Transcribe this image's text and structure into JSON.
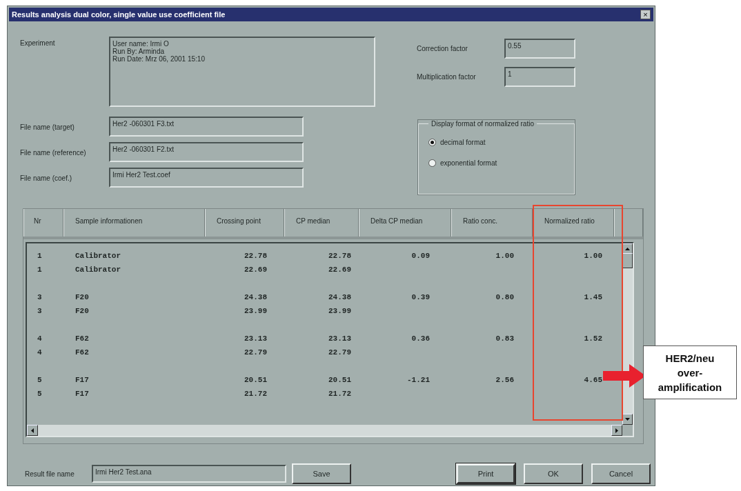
{
  "window": {
    "title": "Results analysis dual color, single value use coefficient file",
    "close": "×"
  },
  "experiment": {
    "label": "Experiment",
    "lines": [
      "User name: Irmi O",
      "Run By: Arminda",
      "Run Date: Mrz 06, 2001 15:10"
    ]
  },
  "files": [
    {
      "label": "File name (target)",
      "value": "Her2 -060301 F3.txt"
    },
    {
      "label": "File name (reference)",
      "value": "Her2 -060301 F2.txt"
    },
    {
      "label": "File name (coef.)",
      "value": "Irmi Her2 Test.coef"
    }
  ],
  "factors": [
    {
      "label": "Correction factor",
      "value": "0.55"
    },
    {
      "label": "Multiplication factor",
      "value": "1"
    }
  ],
  "display_format": {
    "title": "Display format of normalized ratio",
    "options": [
      {
        "label": "decimal format",
        "selected": true
      },
      {
        "label": "exponential format",
        "selected": false
      }
    ]
  },
  "table": {
    "columns": [
      "Nr",
      "Sample informationen",
      "Crossing point",
      "CP median",
      "Delta CP median",
      "Ratio conc.",
      "Normalized ratio"
    ],
    "groups": [
      {
        "rows": [
          {
            "nr": "1",
            "sample": "Calibrator",
            "crossing_point": "22.78",
            "cp_median": "22.78",
            "delta_cp_median": "0.09",
            "ratio_conc": "1.00",
            "normalized_ratio": "1.00"
          },
          {
            "nr": "1",
            "sample": "Calibrator",
            "crossing_point": "22.69",
            "cp_median": "22.69"
          }
        ]
      },
      {
        "rows": [
          {
            "nr": "3",
            "sample": "F20",
            "crossing_point": "24.38",
            "cp_median": "24.38",
            "delta_cp_median": "0.39",
            "ratio_conc": "0.80",
            "normalized_ratio": "1.45"
          },
          {
            "nr": "3",
            "sample": "F20",
            "crossing_point": "23.99",
            "cp_median": "23.99"
          }
        ]
      },
      {
        "rows": [
          {
            "nr": "4",
            "sample": "F62",
            "crossing_point": "23.13",
            "cp_median": "23.13",
            "delta_cp_median": "0.36",
            "ratio_conc": "0.83",
            "normalized_ratio": "1.52"
          },
          {
            "nr": "4",
            "sample": "F62",
            "crossing_point": "22.79",
            "cp_median": "22.79"
          }
        ]
      },
      {
        "rows": [
          {
            "nr": "5",
            "sample": "F17",
            "crossing_point": "20.51",
            "cp_median": "20.51",
            "delta_cp_median": "-1.21",
            "ratio_conc": "2.56",
            "normalized_ratio": "4.65"
          },
          {
            "nr": "5",
            "sample": "F17",
            "crossing_point": "21.72",
            "cp_median": "21.72"
          }
        ]
      }
    ]
  },
  "result_file": {
    "label": "Result file name",
    "value": "Irmi Her2 Test.ana"
  },
  "buttons": [
    {
      "label": "Save",
      "kind": "side"
    },
    {
      "label": "Print",
      "kind": "default"
    },
    {
      "label": "OK",
      "kind": "plain"
    },
    {
      "label": "Cancel",
      "kind": "plain"
    }
  ],
  "annotation": {
    "lines": [
      "HER2/neu",
      "over-",
      "amplification"
    ]
  }
}
